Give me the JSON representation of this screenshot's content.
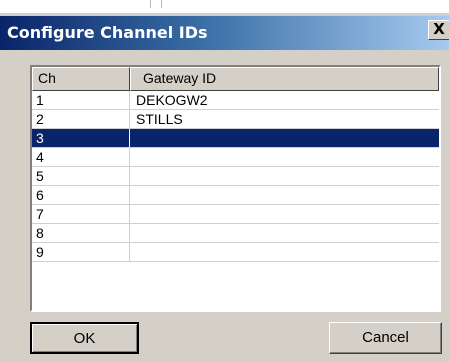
{
  "window": {
    "title": "Configure Channel IDs",
    "close_glyph": "X"
  },
  "list": {
    "columns": [
      "Ch",
      "Gateway ID"
    ],
    "rows": [
      {
        "ch": "1",
        "gateway": "DEKOGW2"
      },
      {
        "ch": "2",
        "gateway": "STILLS"
      },
      {
        "ch": "3",
        "gateway": "",
        "selected": true
      },
      {
        "ch": "4",
        "gateway": ""
      },
      {
        "ch": "5",
        "gateway": ""
      },
      {
        "ch": "6",
        "gateway": ""
      },
      {
        "ch": "7",
        "gateway": ""
      },
      {
        "ch": "8",
        "gateway": ""
      },
      {
        "ch": "9",
        "gateway": ""
      }
    ]
  },
  "buttons": {
    "ok": "OK",
    "cancel": "Cancel"
  },
  "colors": {
    "selection": "#0a246a",
    "face": "#d4d0c8",
    "titlebar_start": "#0a246a",
    "titlebar_end": "#a6caf0"
  }
}
